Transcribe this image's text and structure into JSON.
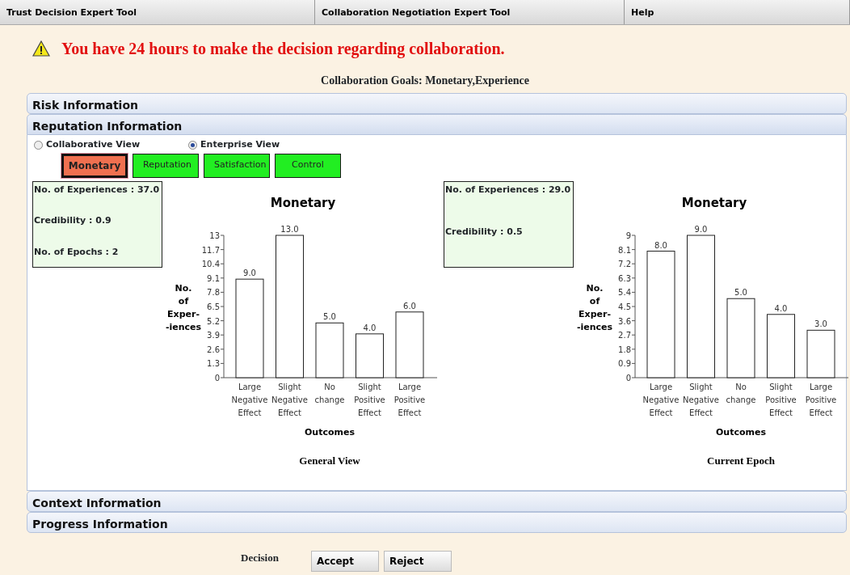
{
  "menu_bar": [
    {
      "label": "Trust Decision Expert Tool"
    },
    {
      "label": "Collaboration Negotiation Expert Tool"
    },
    {
      "label": "Help"
    }
  ],
  "warning": "You have 24 hours to make the decision regarding collaboration.",
  "goals": "Collaboration Goals: Monetary,Experience",
  "sections": [
    {
      "title": "Risk Information",
      "expanded": false
    },
    {
      "title": "Reputation Information",
      "expanded": true,
      "views": [
        {
          "label": "Collaborative View",
          "selected": false
        },
        {
          "label": "Enterprise View",
          "selected": true
        }
      ],
      "tabs": [
        {
          "label": "Monetary",
          "selected": true
        },
        {
          "label": "Reputation",
          "selected": false
        },
        {
          "label": "Satisfaction",
          "selected": false
        },
        {
          "label": "Control",
          "selected": false
        }
      ],
      "panels": [
        {
          "info": [
            "No. of Experiences : 37.0",
            "Credibility : 0.9",
            "No. of Epochs : 2"
          ],
          "caption": "General View",
          "chart_data": {
            "type": "bar",
            "title": "Monetary",
            "xlabel": "Outcomes",
            "ylabel": "No. of Exper- -iences",
            "categories": [
              "Large Negative Effect",
              "Slight Negative Effect",
              "No change",
              "Slight Positive Effect",
              "Large Positive Effect"
            ],
            "series": [
              {
                "color": "#ffffff",
                "values": [
                  9.0,
                  13.0,
                  5.0,
                  4.0,
                  6.0
                ]
              }
            ],
            "ylim": [
              0,
              13
            ],
            "yticks": [
              0,
              1.3,
              2.6,
              3.9,
              5.2,
              6.5,
              7.8,
              9.1,
              10.4,
              11.7,
              13
            ],
            "value_labels": [
              "9.0",
              "13.0",
              "5.0",
              "4.0",
              "6.0"
            ]
          }
        },
        {
          "info": [
            "No. of Experiences : 29.0",
            "Credibility : 0.5"
          ],
          "caption": "Current Epoch",
          "chart_data": {
            "type": "bar",
            "title": "Monetary",
            "xlabel": "Outcomes",
            "ylabel": "No. of Exper- -iences",
            "categories": [
              "Large Negative Effect",
              "Slight Negative Effect",
              "No change",
              "Slight Positive Effect",
              "Large Positive Effect"
            ],
            "series": [
              {
                "color": "#ffffff",
                "values": [
                  8.0,
                  9.0,
                  5.0,
                  4.0,
                  3.0
                ]
              }
            ],
            "ylim": [
              0,
              9
            ],
            "yticks": [
              0,
              0.9,
              1.8,
              2.7,
              3.6,
              4.5,
              5.4,
              6.3,
              7.2,
              8.1,
              9
            ],
            "value_labels": [
              "8.0",
              "9.0",
              "5.0",
              "4.0",
              "3.0"
            ]
          }
        }
      ]
    },
    {
      "title": "Context Information",
      "expanded": false
    },
    {
      "title": "Progress Information",
      "expanded": false
    }
  ],
  "decision": {
    "label": "Decision",
    "buttons": [
      "Accept",
      "Reject"
    ]
  }
}
